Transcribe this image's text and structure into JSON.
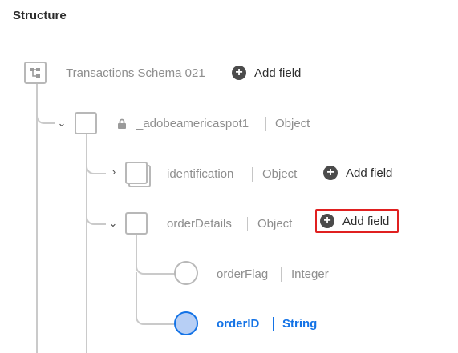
{
  "title": "Structure",
  "root": {
    "name": "Transactions Schema 021",
    "add_label": "Add field"
  },
  "node_adobe": {
    "name": "_adobeamericaspot1",
    "type": "Object"
  },
  "node_identification": {
    "name": "identification",
    "type": "Object",
    "add_label": "Add field"
  },
  "node_orderdetails": {
    "name": "orderDetails",
    "type": "Object",
    "add_label": "Add field"
  },
  "node_orderflag": {
    "name": "orderFlag",
    "type": "Integer"
  },
  "node_orderid": {
    "name": "orderID",
    "type": "String"
  },
  "colors": {
    "accent": "#1473e6",
    "highlight": "#e02020",
    "selected_fill": "#b7cff5"
  },
  "icons": {
    "schema": "schema-icon",
    "lock": "lock-icon",
    "plus": "plus-circle-icon",
    "expand": "chevron-right-icon",
    "collapse": "chevron-down-icon"
  }
}
